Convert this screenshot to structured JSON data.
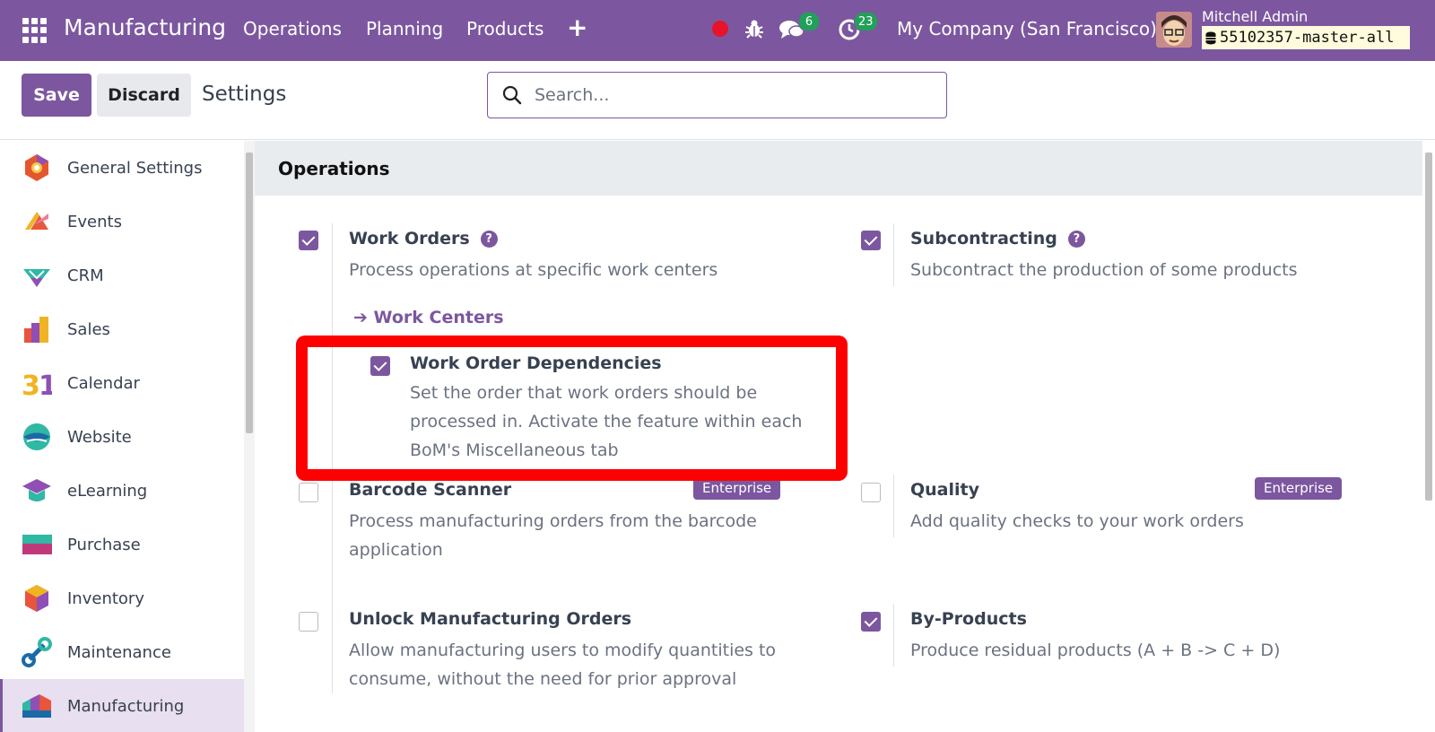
{
  "navbar": {
    "brand": "Manufacturing",
    "menus": [
      "Operations",
      "Planning",
      "Products"
    ],
    "add_symbol": "+",
    "messages_count": "6",
    "activities_count": "23",
    "company": "My Company (San Francisco)",
    "user_name": "Mitchell Admin",
    "database": "55102357-master-all",
    "accent_color": "#7c579f"
  },
  "control": {
    "save_label": "Save",
    "discard_label": "Discard",
    "title": "Settings",
    "search_placeholder": "Search..."
  },
  "sidebar": {
    "items": [
      {
        "label": "General Settings",
        "icon": "general-settings-icon"
      },
      {
        "label": "Events",
        "icon": "events-icon"
      },
      {
        "label": "CRM",
        "icon": "crm-icon"
      },
      {
        "label": "Sales",
        "icon": "sales-icon"
      },
      {
        "label": "Calendar",
        "icon": "calendar-icon"
      },
      {
        "label": "Website",
        "icon": "website-icon"
      },
      {
        "label": "eLearning",
        "icon": "elearning-icon"
      },
      {
        "label": "Purchase",
        "icon": "purchase-icon"
      },
      {
        "label": "Inventory",
        "icon": "inventory-icon"
      },
      {
        "label": "Maintenance",
        "icon": "maintenance-icon"
      },
      {
        "label": "Manufacturing",
        "icon": "manufacturing-icon",
        "active": true
      }
    ]
  },
  "operations": {
    "title": "Operations",
    "work_orders": {
      "title": "Work Orders",
      "desc": "Process operations at specific work centers",
      "checked": true,
      "link": "Work Centers"
    },
    "work_order_dependencies": {
      "title": "Work Order Dependencies",
      "desc": "Set the order that work orders should be processed in. Activate the feature within each BoM's Miscellaneous tab",
      "checked": true
    },
    "subcontracting": {
      "title": "Subcontracting",
      "desc": "Subcontract the production of some products",
      "checked": true
    },
    "barcode_scanner": {
      "title": "Barcode Scanner",
      "desc": "Process manufacturing orders from the barcode application",
      "checked": false,
      "badge": "Enterprise"
    },
    "quality": {
      "title": "Quality",
      "desc": "Add quality checks to your work orders",
      "checked": false,
      "badge": "Enterprise"
    },
    "unlock_orders": {
      "title": "Unlock Manufacturing Orders",
      "desc": "Allow manufacturing users to modify quantities to consume, without the need for prior approval",
      "checked": false
    },
    "by_products": {
      "title": "By-Products",
      "desc": "Produce residual products (A + B -> C + D)",
      "checked": true
    }
  }
}
